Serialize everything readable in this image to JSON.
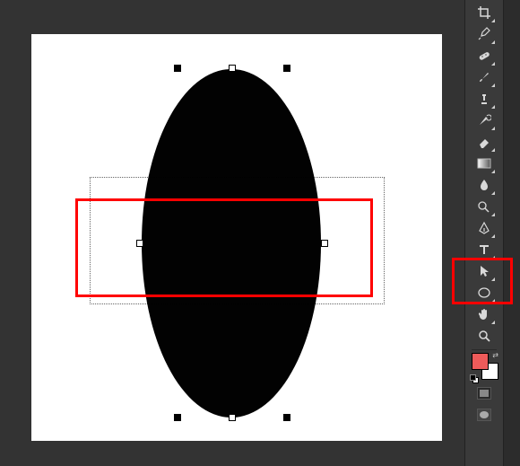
{
  "canvas": {
    "shape": "ellipse",
    "fill": "#020202"
  },
  "annotations": {
    "red_box_canvas": true,
    "red_box_tool": "path-selection-tool"
  },
  "swatches": {
    "foreground": "#ee5b5a",
    "background": "#ffffff"
  },
  "tools": [
    {
      "id": "crop-tool",
      "label": "Crop Tool"
    },
    {
      "id": "eyedropper-tool",
      "label": "Eyedropper Tool"
    },
    {
      "id": "healing-brush-tool",
      "label": "Spot Healing Brush Tool"
    },
    {
      "id": "brush-tool",
      "label": "Brush Tool"
    },
    {
      "id": "clone-stamp-tool",
      "label": "Clone Stamp Tool"
    },
    {
      "id": "history-brush-tool",
      "label": "History Brush Tool"
    },
    {
      "id": "eraser-tool",
      "label": "Eraser Tool"
    },
    {
      "id": "gradient-tool",
      "label": "Gradient Tool"
    },
    {
      "id": "blur-tool",
      "label": "Blur Tool"
    },
    {
      "id": "dodge-tool",
      "label": "Dodge Tool"
    },
    {
      "id": "pen-tool",
      "label": "Pen Tool"
    },
    {
      "id": "type-tool",
      "label": "Horizontal Type Tool"
    },
    {
      "id": "path-selection-tool",
      "label": "Path Selection Tool"
    },
    {
      "id": "shape-tool",
      "label": "Ellipse Tool"
    },
    {
      "id": "hand-tool",
      "label": "Hand Tool"
    },
    {
      "id": "zoom-tool",
      "label": "Zoom Tool"
    }
  ]
}
